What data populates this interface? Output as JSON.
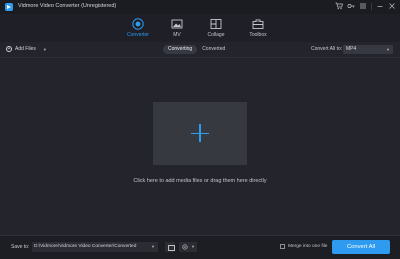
{
  "window": {
    "title": "Vidmore Video Converter (Unregistered)",
    "controls": [
      "cart-icon",
      "key-icon",
      "menu-icon",
      "minimize-icon",
      "close-icon"
    ]
  },
  "nav": {
    "tabs": [
      {
        "label": "Converter",
        "icon": "converter-icon",
        "active": true
      },
      {
        "label": "MV",
        "icon": "mv-icon",
        "active": false
      },
      {
        "label": "Collage",
        "icon": "collage-icon",
        "active": false
      },
      {
        "label": "Toolbox",
        "icon": "toolbox-icon",
        "active": false
      }
    ]
  },
  "toolbar": {
    "add_files": "Add Files",
    "segments": [
      {
        "label": "Converting",
        "active": true
      },
      {
        "label": "Converted",
        "active": false
      }
    ],
    "convert_all_to": "Convert All to:",
    "format": "MP4"
  },
  "main": {
    "hint": "Click here to add media files or drag them here directly"
  },
  "footer": {
    "save_to": "Save to:",
    "path": "D:\\Vidmore\\Vidmore Video Converter\\Converted",
    "merge_label": "Merge into one file",
    "convert_all": "Convert All"
  },
  "colors": {
    "accent": "#2e9bf0",
    "background": "#24252c",
    "panel": "#373941"
  }
}
